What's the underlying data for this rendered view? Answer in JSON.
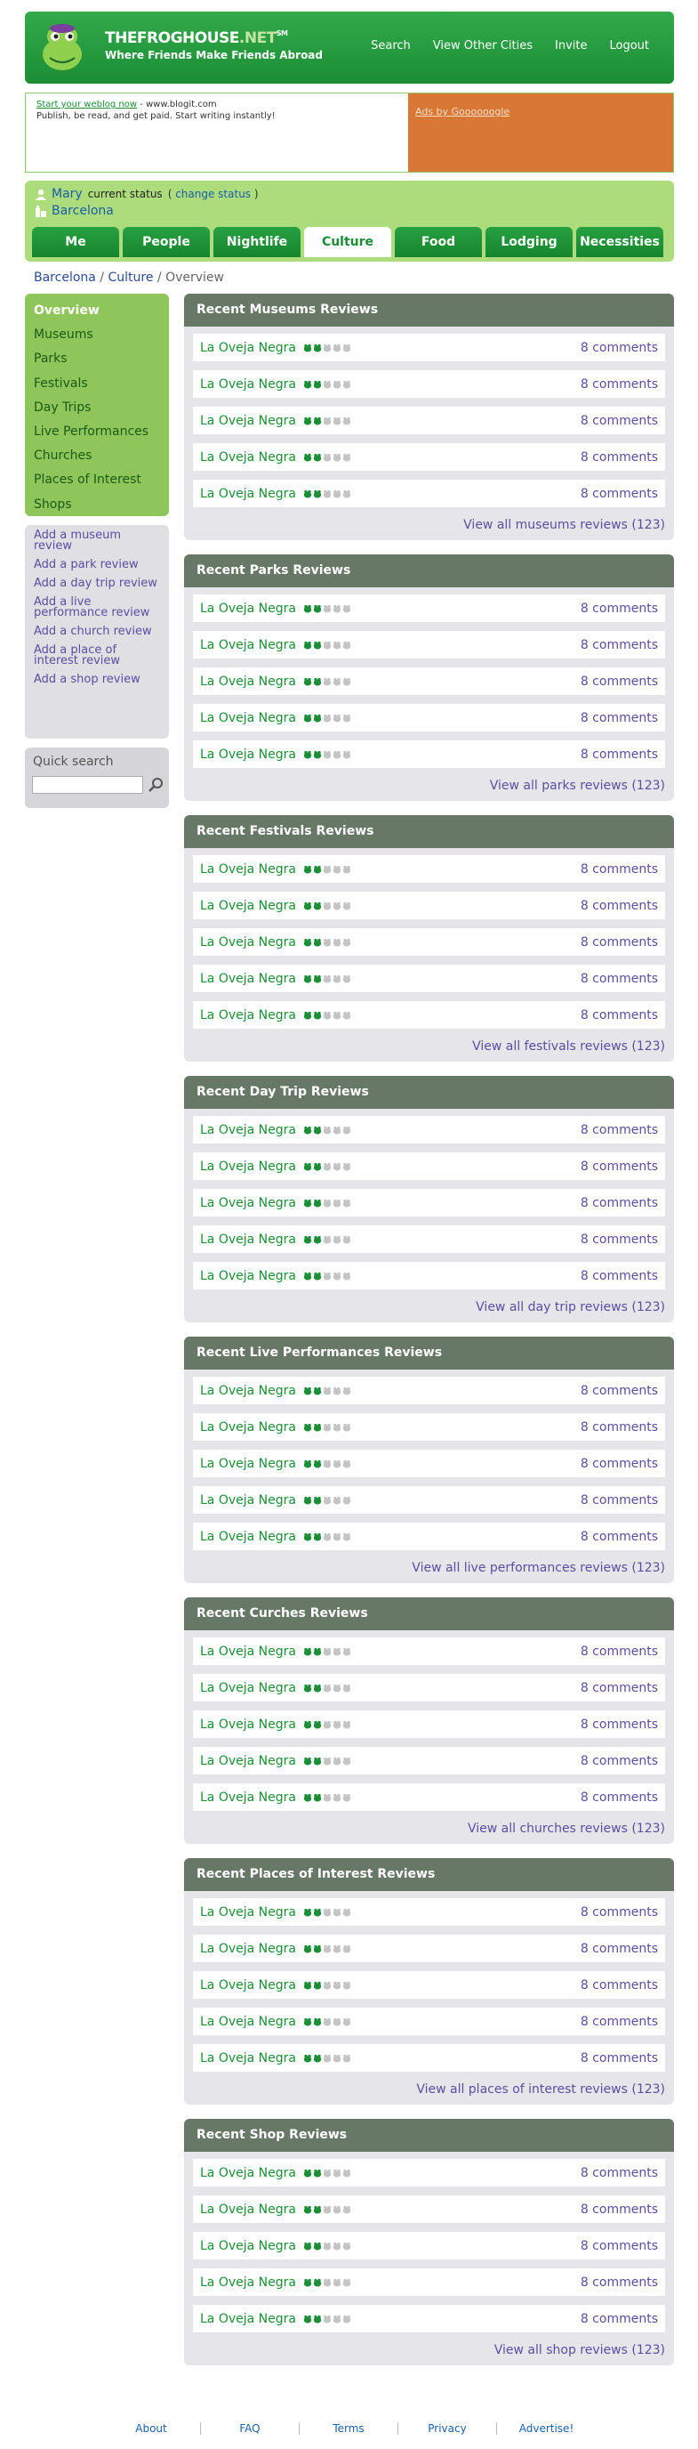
{
  "brand": {
    "title_main": "THEFROGHOUSE",
    "title_ext": ".NET",
    "title_mark": "SM",
    "tagline": "Where Friends Make Friends Abroad"
  },
  "topnav": [
    {
      "label": "Search"
    },
    {
      "label": "View Other Cities"
    },
    {
      "label": "Invite"
    },
    {
      "label": "Logout"
    }
  ],
  "ad": {
    "link": "Start your weblog now",
    "url": " - www.blogit.com",
    "text": "Publish, be read, and get paid. Start writing instantly!",
    "ads_by": "Ads by Goooooogle"
  },
  "user": {
    "name": "Mary",
    "status_label": "current status",
    "change_open": "(",
    "change_link": "change status",
    "change_close": ")",
    "city": "Barcelona"
  },
  "tabs": [
    {
      "label": "Me"
    },
    {
      "label": "People"
    },
    {
      "label": "Nightlife"
    },
    {
      "label": "Culture",
      "active": true
    },
    {
      "label": "Food"
    },
    {
      "label": "Lodging"
    },
    {
      "label": "Necessities"
    }
  ],
  "breadcrumb": {
    "city": "Barcelona",
    "sep1": " / ",
    "section": "Culture",
    "sep2": " / ",
    "current": "Overview"
  },
  "sidenav": [
    {
      "label": "Overview",
      "active": true
    },
    {
      "label": "Museums"
    },
    {
      "label": "Parks"
    },
    {
      "label": "Festivals"
    },
    {
      "label": "Day Trips"
    },
    {
      "label": "Live Performances"
    },
    {
      "label": "Churches"
    },
    {
      "label": "Places of Interest"
    },
    {
      "label": "Shops"
    }
  ],
  "add_links": [
    {
      "label": "Add a museum review"
    },
    {
      "label": "Add a park review"
    },
    {
      "label": "Add a day trip review"
    },
    {
      "label": "Add a live performance review"
    },
    {
      "label": "Add a church review"
    },
    {
      "label": "Add a place of interest review"
    },
    {
      "label": "Add a shop review"
    }
  ],
  "quick_search": {
    "label": "Quick search",
    "value": ""
  },
  "sections": [
    {
      "title": "Recent Museums Reviews",
      "view_all": "View all museums reviews (123)"
    },
    {
      "title": "Recent Parks Reviews",
      "view_all": "View all parks reviews (123)"
    },
    {
      "title": "Recent Festivals Reviews",
      "view_all": "View all festivals reviews (123)"
    },
    {
      "title": "Recent Day Trip Reviews",
      "view_all": "View all day trip reviews (123)"
    },
    {
      "title": "Recent Live Performances Reviews",
      "view_all": "View all live performances reviews (123)"
    },
    {
      "title": "Recent Curches Reviews",
      "view_all": "View all churches reviews (123)"
    },
    {
      "title": "Recent Places of Interest Reviews",
      "view_all": "View all places of interest reviews (123)"
    },
    {
      "title": "Recent Shop Reviews",
      "view_all": "View all shop reviews (123)"
    }
  ],
  "review_row": {
    "place": "La Oveja Negra",
    "rating": 2,
    "rating_max": 5,
    "comments": "8 comments"
  },
  "footer": [
    {
      "label": "About"
    },
    {
      "label": "FAQ"
    },
    {
      "label": "Terms"
    },
    {
      "label": "Privacy"
    },
    {
      "label": "Advertise!"
    }
  ],
  "colors": {
    "brand_green": "#1b8e36",
    "light_green": "#acdc7c",
    "section_header": "#687866",
    "link_purple": "#5a4ea0",
    "ad_orange": "#d97734"
  }
}
